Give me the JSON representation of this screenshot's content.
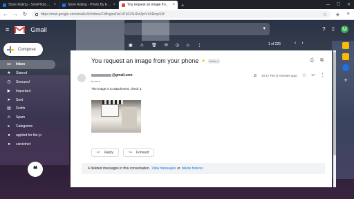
{
  "browser": {
    "tabs": [
      {
        "label": "Store Rating - SmsPhotoEmail",
        "color": "#1a73e8",
        "active": false
      },
      {
        "label": "Store Rating - Photo By Email",
        "color": "#1a73e8",
        "active": false
      },
      {
        "label": "You request an image from yo",
        "color": "#ea4335",
        "active": true
      }
    ],
    "url": "https://mail.google.com/mail/u/0/#inbox/FMfcgxwDsFdTkFFNJRzZprVLBRrqvSM"
  },
  "gmail": {
    "brand": "Gmail",
    "avatar_letter": "M",
    "compose_label": "Compose",
    "sidebar": [
      {
        "label": "Inbox",
        "icon": "inbox-icon",
        "glyph": "▭"
      },
      {
        "label": "Starred",
        "icon": "star-icon",
        "glyph": "★"
      },
      {
        "label": "Snoozed",
        "icon": "clock-icon",
        "glyph": "◷"
      },
      {
        "label": "Important",
        "icon": "important-icon",
        "glyph": "▶"
      },
      {
        "label": "Sent",
        "icon": "send-icon",
        "glyph": "➤"
      },
      {
        "label": "Drafts",
        "icon": "draft-icon",
        "glyph": "▤"
      },
      {
        "label": "Spam",
        "icon": "spam-icon",
        "glyph": "⚠"
      },
      {
        "label": "Categories",
        "icon": "label-icon",
        "glyph": "▸"
      },
      {
        "label": "applied for the jo",
        "icon": "label-icon",
        "glyph": "●"
      },
      {
        "label": "caivietnet",
        "icon": "label-icon",
        "glyph": "●"
      }
    ],
    "pager": "1 of 225"
  },
  "email": {
    "subject": "You request an image from your phone",
    "label_badge": "Inbox ×",
    "sender_domain": "@gmail.com",
    "to_line": "to me ▾",
    "time": "10:17 PM (2 minutes ago)",
    "body": "The image is to attachment, check it.",
    "reply_label": "Reply",
    "forward_label": "Forward",
    "deleted_count_text": "4 deleted messages in this conversation.",
    "view_messages": "View messages",
    "or_text": "or",
    "delete_forever": "delete forever."
  }
}
